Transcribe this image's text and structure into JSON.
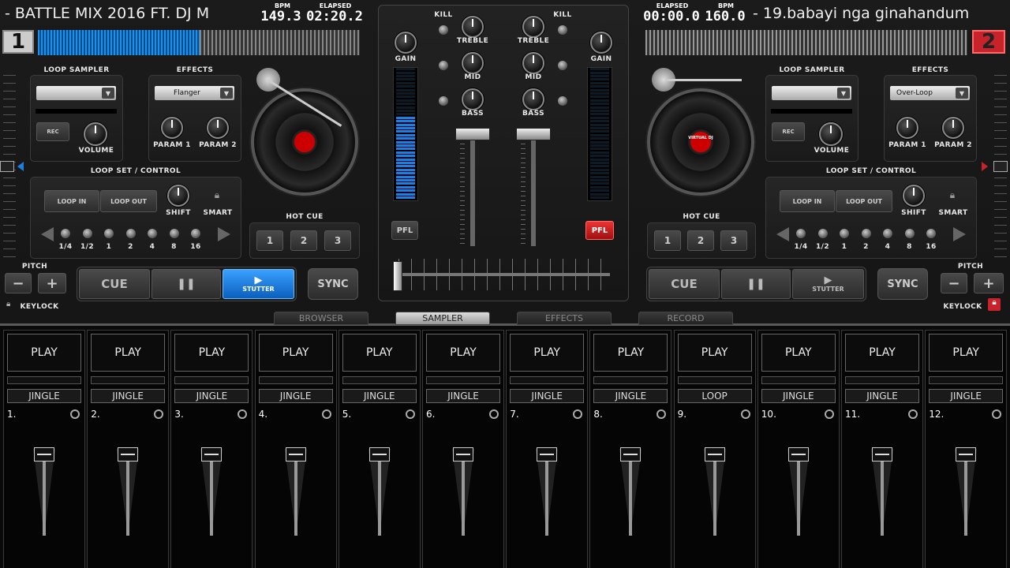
{
  "deck_left": {
    "title": "- BATTLE MIX 2016 FT. DJ M",
    "bpm_label": "BPM",
    "bpm": "149.3",
    "elapsed_label": "ELAPSED",
    "elapsed": "02:20.2",
    "deck_number": "1",
    "loop_sampler": "LOOP SAMPLER",
    "rec": "REC",
    "volume": "VOLUME",
    "effects": "EFFECTS",
    "effect_selected": "Flanger",
    "param1": "PARAM 1",
    "param2": "PARAM 2",
    "loop_set": "LOOP SET / CONTROL",
    "loop_in": "LOOP IN",
    "loop_out": "LOOP OUT",
    "shift": "SHIFT",
    "smart": "SMART",
    "loop_sizes": [
      "1/4",
      "1/2",
      "1",
      "2",
      "4",
      "8",
      "16"
    ],
    "hot_cue": "HOT CUE",
    "hot_cues": [
      "1",
      "2",
      "3"
    ],
    "pitch": "PITCH",
    "keylock": "KEYLOCK",
    "cue": "CUE",
    "pause": "❚❚",
    "stutter": "STUTTER",
    "sync": "SYNC",
    "platter_label": ""
  },
  "deck_right": {
    "title": "- 19.babayi nga ginahandum",
    "bpm_label": "BPM",
    "bpm": "160.0",
    "elapsed_label": "ELAPSED",
    "elapsed": "00:00.0",
    "deck_number": "2",
    "loop_sampler": "LOOP SAMPLER",
    "rec": "REC",
    "volume": "VOLUME",
    "effects": "EFFECTS",
    "effect_selected": "Over-Loop",
    "param1": "PARAM 1",
    "param2": "PARAM 2",
    "loop_set": "LOOP SET / CONTROL",
    "loop_in": "LOOP IN",
    "loop_out": "LOOP OUT",
    "shift": "SHIFT",
    "smart": "SMART",
    "loop_sizes": [
      "1/4",
      "1/2",
      "1",
      "2",
      "4",
      "8",
      "16"
    ],
    "hot_cue": "HOT CUE",
    "hot_cues": [
      "1",
      "2",
      "3"
    ],
    "pitch": "PITCH",
    "keylock": "KEYLOCK",
    "cue": "CUE",
    "pause": "❚❚",
    "stutter": "STUTTER",
    "sync": "SYNC",
    "platter_label": "VIRTUAL DJ"
  },
  "mixer": {
    "gain": "GAIN",
    "kill": "KILL",
    "treble": "TREBLE",
    "mid": "MID",
    "bass": "BASS",
    "pfl": "PFL"
  },
  "tabs": [
    "BROWSER",
    "SAMPLER",
    "EFFECTS",
    "RECORD"
  ],
  "active_tab": "SAMPLER",
  "sampler": [
    {
      "play": "PLAY",
      "mode": "JINGLE",
      "num": "1."
    },
    {
      "play": "PLAY",
      "mode": "JINGLE",
      "num": "2."
    },
    {
      "play": "PLAY",
      "mode": "JINGLE",
      "num": "3."
    },
    {
      "play": "PLAY",
      "mode": "JINGLE",
      "num": "4."
    },
    {
      "play": "PLAY",
      "mode": "JINGLE",
      "num": "5."
    },
    {
      "play": "PLAY",
      "mode": "JINGLE",
      "num": "6."
    },
    {
      "play": "PLAY",
      "mode": "JINGLE",
      "num": "7."
    },
    {
      "play": "PLAY",
      "mode": "JINGLE",
      "num": "8."
    },
    {
      "play": "PLAY",
      "mode": "LOOP",
      "num": "9."
    },
    {
      "play": "PLAY",
      "mode": "JINGLE",
      "num": "10."
    },
    {
      "play": "PLAY",
      "mode": "JINGLE",
      "num": "11."
    },
    {
      "play": "PLAY",
      "mode": "JINGLE",
      "num": "12."
    }
  ],
  "colors": {
    "accent": "#1a7fe0",
    "pfl_active": "#d42020",
    "deck_badge": "#c8232b"
  }
}
